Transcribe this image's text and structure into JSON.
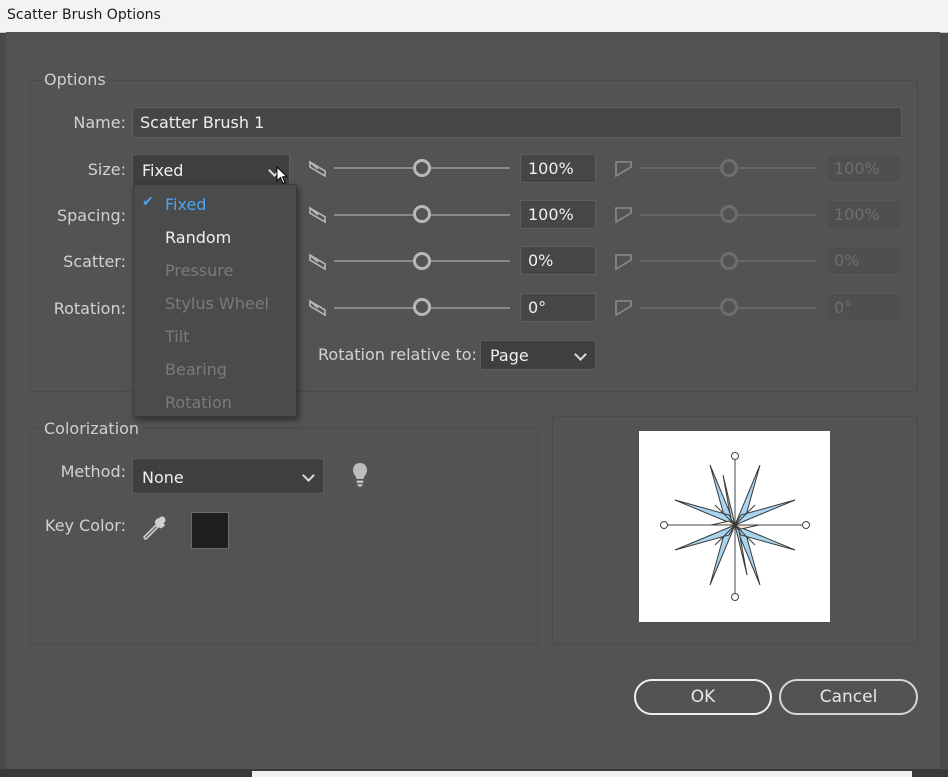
{
  "window": {
    "title": "Scatter Brush Options"
  },
  "options": {
    "section_title": "Options",
    "name_label": "Name:",
    "name_value": "Scatter Brush 1",
    "rows": [
      {
        "label": "Size:",
        "dropdown_value": "Fixed",
        "value": "100%",
        "max_value": "100%"
      },
      {
        "label": "Spacing:",
        "value": "100%",
        "max_value": "100%"
      },
      {
        "label": "Scatter:",
        "value": "0%",
        "max_value": "0%"
      },
      {
        "label": "Rotation:",
        "value": "0°",
        "max_value": "0°"
      }
    ],
    "rotation_relative_label": "Rotation relative to:",
    "rotation_relative_value": "Page"
  },
  "size_menu": {
    "items": [
      {
        "label": "Fixed",
        "state": "selected"
      },
      {
        "label": "Random",
        "state": "enabled"
      },
      {
        "label": "Pressure",
        "state": "disabled"
      },
      {
        "label": "Stylus Wheel",
        "state": "disabled"
      },
      {
        "label": "Tilt",
        "state": "disabled"
      },
      {
        "label": "Bearing",
        "state": "disabled"
      },
      {
        "label": "Rotation",
        "state": "disabled"
      }
    ]
  },
  "colorization": {
    "section_title": "Colorization",
    "method_label": "Method:",
    "method_value": "None",
    "key_color_label": "Key Color:",
    "key_color": "#1e1e1e",
    "tips_icon": "lightbulb-icon",
    "eyedropper_icon": "eyedropper-icon"
  },
  "buttons": {
    "ok": "OK",
    "cancel": "Cancel"
  },
  "colors": {
    "selected_item": "#4ea3f5",
    "disabled_text": "#7a7a7a",
    "star_blue": "#a9d4ef",
    "star_cream": "#fbecd6"
  }
}
